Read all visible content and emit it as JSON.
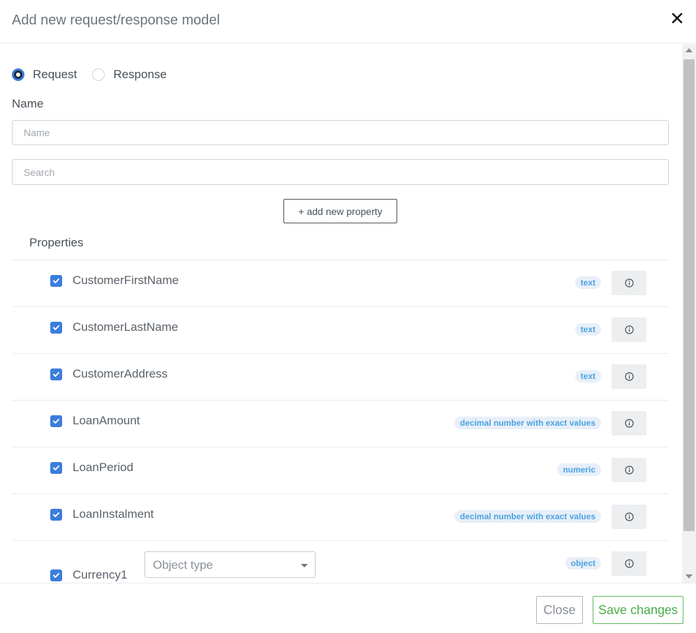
{
  "header": {
    "title": "Add new request/response model",
    "close_icon": "close-icon"
  },
  "model_kind": {
    "options": [
      {
        "label": "Request",
        "checked": true
      },
      {
        "label": "Response",
        "checked": false
      }
    ]
  },
  "name_field": {
    "label": "Name",
    "value": "",
    "placeholder": "Name"
  },
  "search_field": {
    "value": "",
    "placeholder": "Search"
  },
  "add_property": {
    "label": "+ add new property"
  },
  "properties": {
    "title": "Properties",
    "items": [
      {
        "name": "CustomerFirstName",
        "type": "text",
        "checked": true
      },
      {
        "name": "CustomerLastName",
        "type": "text",
        "checked": true
      },
      {
        "name": "CustomerAddress",
        "type": "text",
        "checked": true
      },
      {
        "name": "LoanAmount",
        "type": "decimal number with exact values",
        "checked": true
      },
      {
        "name": "LoanPeriod",
        "type": "numeric",
        "checked": true
      },
      {
        "name": "LoanInstalment",
        "type": "decimal number with exact values",
        "checked": true
      },
      {
        "name": "Currency1",
        "type": "object",
        "checked": true,
        "object_type_placeholder": "Object type"
      }
    ]
  },
  "footer": {
    "close_label": "Close",
    "save_label": "Save changes"
  },
  "colors": {
    "accent": "#3b7ddd",
    "badge_text": "#4ba3e3",
    "badge_bg": "#e8eff8",
    "save_green": "#4cae4c"
  },
  "icons": {
    "checkbox": "check-icon",
    "info": "info-icon",
    "select_caret": "chevron-down-icon"
  }
}
